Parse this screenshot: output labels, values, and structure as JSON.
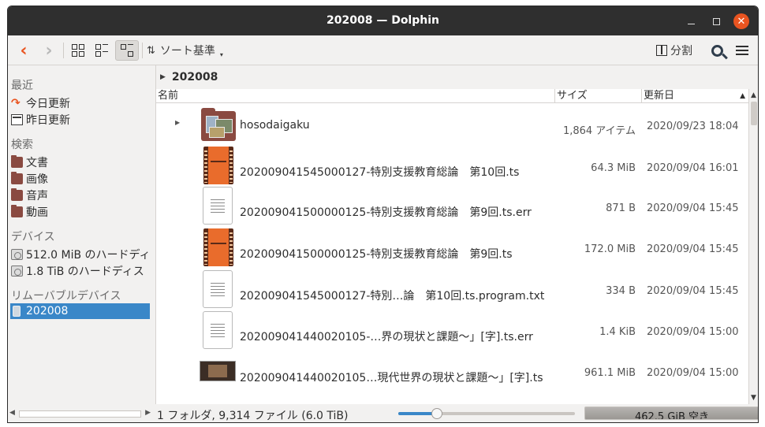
{
  "window": {
    "title": "202008 — Dolphin"
  },
  "toolbar": {
    "back_icon": "chevron-left-icon",
    "forward_icon": "chevron-right-icon",
    "sort_label": "ソート基準",
    "split_label": "分割"
  },
  "sidebar": {
    "sections": [
      {
        "heading": "最近",
        "items": [
          {
            "label": "今日更新",
            "icon": "arrow-icon"
          },
          {
            "label": "昨日更新",
            "icon": "calendar-icon"
          }
        ]
      },
      {
        "heading": "検索",
        "items": [
          {
            "label": "文書",
            "icon": "folder-icon"
          },
          {
            "label": "画像",
            "icon": "folder-icon"
          },
          {
            "label": "音声",
            "icon": "folder-icon"
          },
          {
            "label": "動画",
            "icon": "folder-icon"
          }
        ]
      },
      {
        "heading": "デバイス",
        "items": [
          {
            "label": "512.0 MiB のハードディ",
            "icon": "disk-icon"
          },
          {
            "label": "1.8 TiB のハードディス",
            "icon": "disk-icon"
          }
        ]
      },
      {
        "heading": "リムーバブルデバイス",
        "items": [
          {
            "label": "202008",
            "icon": "usb-icon",
            "selected": true
          }
        ]
      }
    ]
  },
  "breadcrumb": {
    "current": "202008"
  },
  "columns": {
    "name": "名前",
    "size": "サイズ",
    "modified": "更新日"
  },
  "files": [
    {
      "name": "hosodaigaku",
      "size": "1,864 アイテム",
      "modified": "2020/09/23 18:04",
      "type": "folder"
    },
    {
      "name": "202009041545000127-特別支援教育総論　第10回.ts",
      "size": "64.3 MiB",
      "modified": "2020/09/04 16:01",
      "type": "video"
    },
    {
      "name": "202009041500000125-特別支援教育総論　第9回.ts.err",
      "size": "871 B",
      "modified": "2020/09/04 15:45",
      "type": "text"
    },
    {
      "name": "202009041500000125-特別支援教育総論　第9回.ts",
      "size": "172.0 MiB",
      "modified": "2020/09/04 15:45",
      "type": "video"
    },
    {
      "name": "202009041545000127-特別…論　第10回.ts.program.txt",
      "size": "334 B",
      "modified": "2020/09/04 15:45",
      "type": "text"
    },
    {
      "name": "202009041440020105-…界の現状と課題〜」[字].ts.err",
      "size": "1.4 KiB",
      "modified": "2020/09/04 15:00",
      "type": "text"
    },
    {
      "name": "202009041440020105…現代世界の現状と課題〜」[字].ts",
      "size": "961.1 MiB",
      "modified": "2020/09/04 15:00",
      "type": "thumbnail"
    }
  ],
  "status": {
    "summary": "1 フォルダ, 9,314 ファイル (6.0 TiB)",
    "zoom_level": 0.2,
    "free_space": "462.5 GiB 空き"
  },
  "colors": {
    "accent": "#e95420",
    "selection": "#3a87c8",
    "folder": "#8a4a41"
  }
}
